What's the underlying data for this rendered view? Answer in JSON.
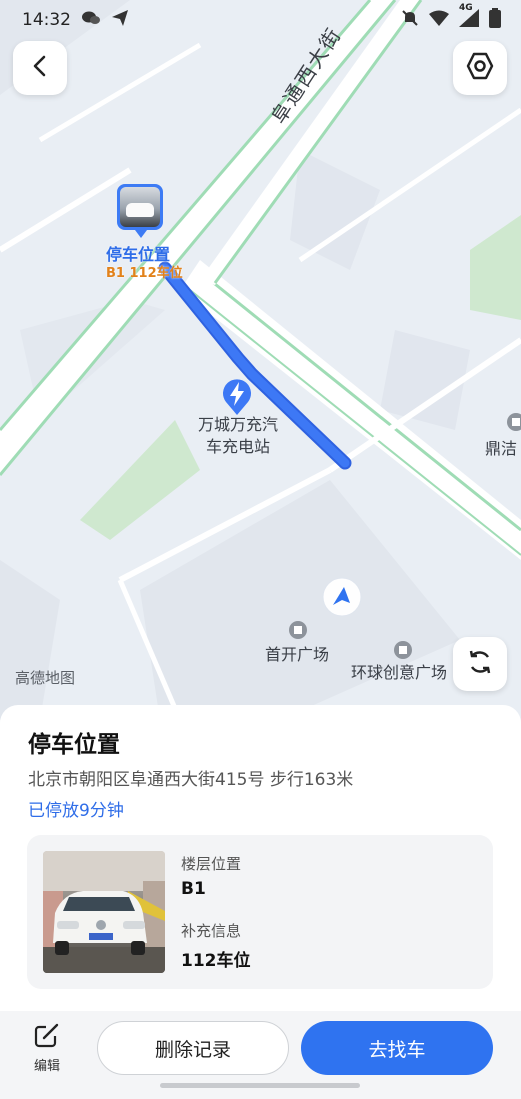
{
  "status": {
    "time": "14:32",
    "network": "4G"
  },
  "map": {
    "road_name": "阜通西大街",
    "poi_charging": {
      "line1": "万城万充汽",
      "line2": "车充电站"
    },
    "poi_dingjie": "鼎洁",
    "poi_shoukai": "首开广场",
    "poi_huanqiu": "环球创意广场",
    "logo": "高德地图",
    "pin": {
      "title": "停车位置",
      "sub": "B1 112车位"
    }
  },
  "sheet": {
    "title": "停车位置",
    "address": "北京市朝阳区阜通西大街415号  步行163米",
    "duration": "已停放9分钟",
    "floor_label": "楼层位置",
    "floor_value": "B1",
    "extra_label": "补充信息",
    "extra_value": "112车位"
  },
  "actions": {
    "edit": "编辑",
    "delete": "删除记录",
    "go": "去找车"
  }
}
